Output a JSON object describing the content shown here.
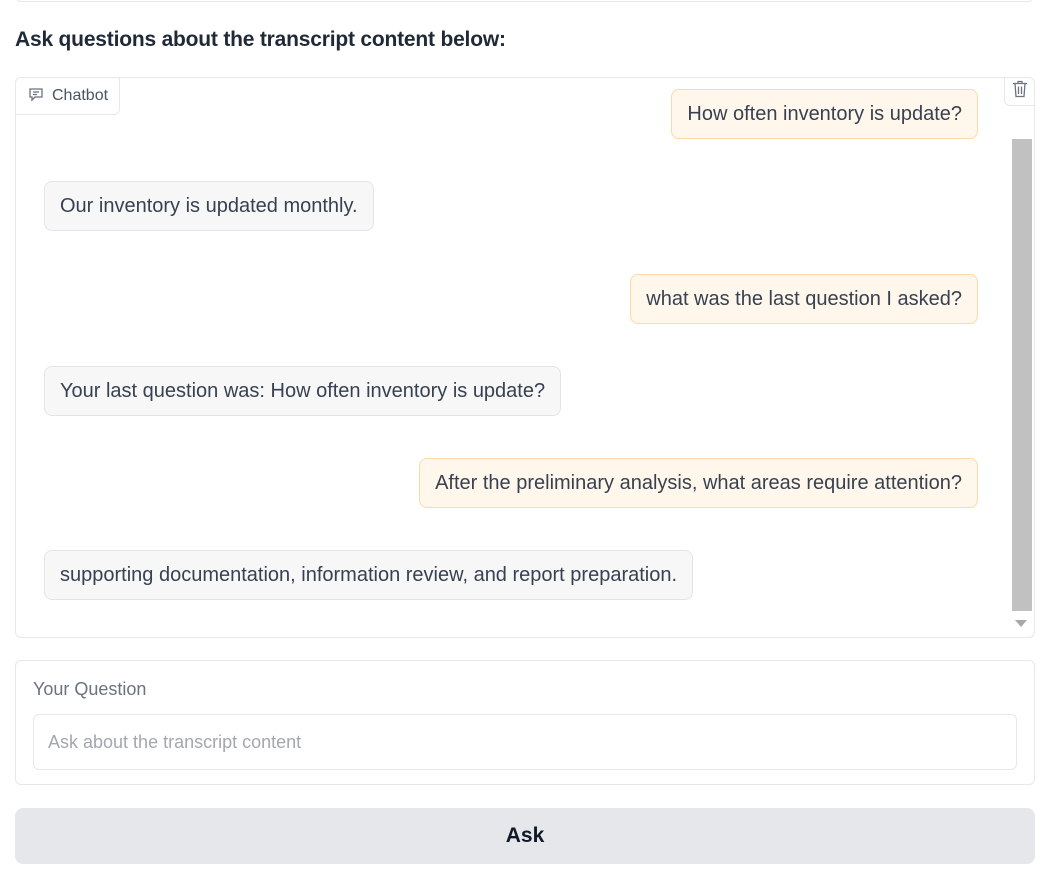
{
  "heading": "Ask questions about the transcript content below:",
  "chatbot": {
    "label": "Chatbot",
    "label_icon": "chat-icon",
    "clear_icon": "trash-icon",
    "messages": [
      {
        "role": "user",
        "text": "How often inventory is update?"
      },
      {
        "role": "bot",
        "text": "Our inventory is updated monthly."
      },
      {
        "role": "user",
        "text": "what was the last question I asked?"
      },
      {
        "role": "bot",
        "text": "Your last question was: How often inventory is update?"
      },
      {
        "role": "user",
        "text": "After the preliminary analysis, what areas require attention?"
      },
      {
        "role": "bot",
        "text": "supporting documentation, information review, and report preparation."
      }
    ]
  },
  "question": {
    "label": "Your Question",
    "placeholder": "Ask about the transcript content",
    "value": ""
  },
  "ask_button": "Ask",
  "colors": {
    "user_bubble_bg": "#fff7ec",
    "user_bubble_border": "#fcd9a8",
    "bot_bubble_bg": "#f7f7f8",
    "button_bg": "#e5e7eb"
  }
}
